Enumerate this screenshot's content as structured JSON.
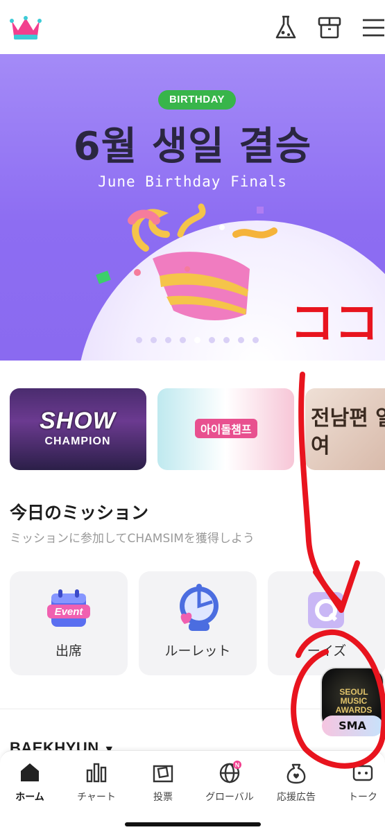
{
  "header": {
    "logo_icon": "crown-icon",
    "icons": [
      "flask-icon",
      "box-icon",
      "menu-icon"
    ]
  },
  "banner": {
    "badge": "BIRTHDAY",
    "title": "6월 생일 결승",
    "subtitle": "June Birthday Finals",
    "slide_count": 9,
    "active_slide": 4
  },
  "cards": [
    {
      "title_line1": "SHOW",
      "title_line2": "CHAMPION"
    },
    {
      "title": "아이돌챔프"
    },
    {
      "title": "전남편 열여"
    }
  ],
  "missions": {
    "title": "今日のミッション",
    "subtitle": "ミッションに参加してCHAMSIMを獲得しよう",
    "items": [
      {
        "label": "出席",
        "badge": "Event"
      },
      {
        "label": "ルーレット"
      },
      {
        "label": "ーイズ"
      }
    ]
  },
  "artist": {
    "name": "BAEKHYUN"
  },
  "sma": {
    "tile_text": "SEOUL MUSIC AWARDS",
    "label": "SMA"
  },
  "annotation": {
    "text": "ココ",
    "color": "#e8141e"
  },
  "nav": {
    "items": [
      {
        "label": "ホーム",
        "icon": "home-icon",
        "active": true
      },
      {
        "label": "チャート",
        "icon": "chart-icon"
      },
      {
        "label": "投票",
        "icon": "vote-icon"
      },
      {
        "label": "グローバル",
        "icon": "globe-icon",
        "badge": "N"
      },
      {
        "label": "応援広告",
        "icon": "support-ad-icon"
      },
      {
        "label": "トーク",
        "icon": "talk-icon"
      }
    ]
  },
  "colors": {
    "banner_purple": "#8d6df2",
    "badge_green": "#38b54a",
    "accent_pink": "#e8508f"
  }
}
